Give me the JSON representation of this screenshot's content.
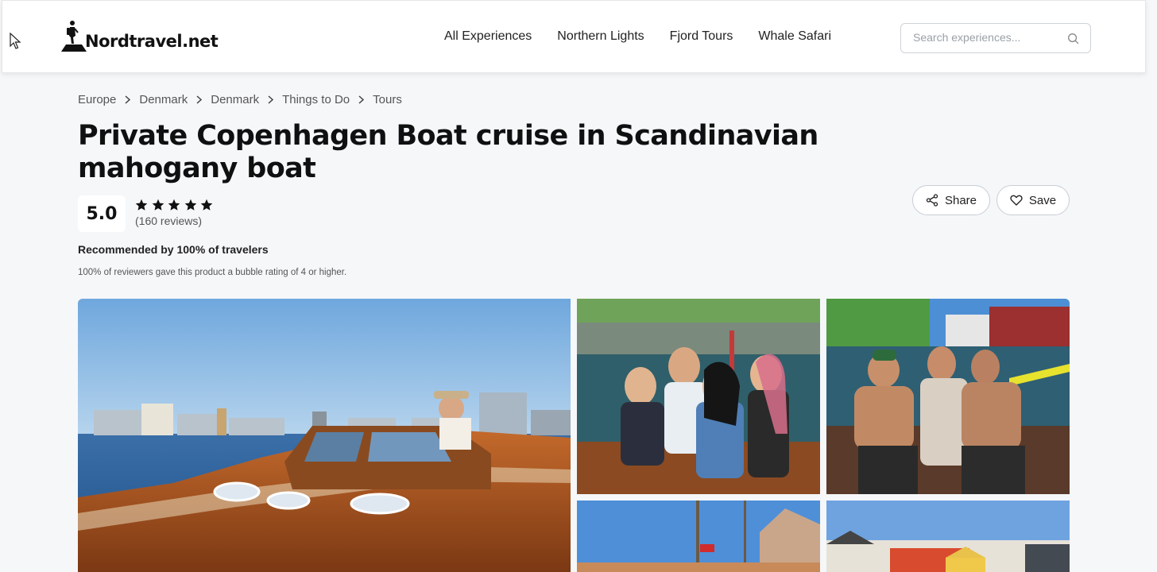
{
  "brand": {
    "name": "Nordtravel.net"
  },
  "nav": [
    {
      "label": "All Experiences"
    },
    {
      "label": "Northern Lights"
    },
    {
      "label": "Fjord Tours"
    },
    {
      "label": "Whale Safari"
    }
  ],
  "search": {
    "placeholder": "Search experiences..."
  },
  "breadcrumb": [
    "Europe",
    "Denmark",
    "Denmark",
    "Things to Do",
    "Tours"
  ],
  "product": {
    "title": "Private Copenhagen Boat cruise in Scandinavian mahogany boat",
    "rating": "5.0",
    "stars": 5,
    "reviews": "(160 reviews)",
    "recommended": "Recommended by 100% of travelers",
    "recommended_note": "100% of reviewers gave this product a bubble rating of 4 or higher."
  },
  "actions": {
    "share": "Share",
    "save": "Save"
  },
  "icons": [
    "cursor-icon",
    "hiker-logo-icon",
    "search-icon",
    "chevron-right-icon",
    "star-icon",
    "share-icon",
    "heart-icon"
  ],
  "colors": {
    "accent": "#0f1111",
    "background": "#f5f7f9",
    "star": "#111111"
  }
}
